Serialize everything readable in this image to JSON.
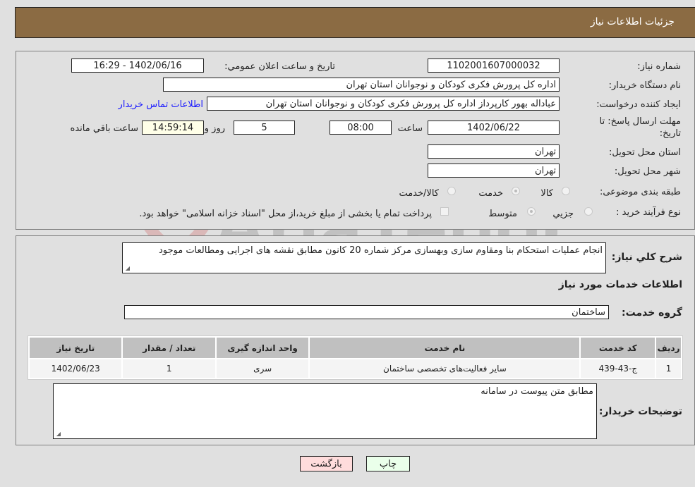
{
  "header": {
    "title": "جزئیات اطلاعات نیاز"
  },
  "fields": {
    "need_number_label": "شماره نیاز:",
    "need_number": "1102001607000032",
    "announce_label": "تاریخ و ساعت اعلان عمومي:",
    "announce_value": "1402/06/16 - 16:29",
    "buyer_org_label": "نام دستگاه خریدار:",
    "buyer_org": "اداره کل پرورش فکری کودکان و نوجوانان استان تهران",
    "creator_label": "ایجاد کننده درخواست:",
    "creator": "عباداله بهور کارپرداز اداره کل پرورش فکری کودکان و نوجوانان استان تهران",
    "contact_link": "اطلاعات تماس خریدار",
    "deadline_label": "مهلت ارسال پاسخ: تا تاریخ:",
    "deadline_date": "1402/06/22",
    "time_label": "ساعت",
    "deadline_time": "08:00",
    "days_value": "5",
    "days_label": "روز و",
    "remaining_time": "14:59:14",
    "remaining_label": "ساعت باقي مانده",
    "province_label": "استان محل تحویل:",
    "province": "تهران",
    "city_label": "شهر محل تحویل:",
    "city": "تهران",
    "category_label": "طبقه بندی موضوعی:",
    "category_options": [
      "کالا",
      "خدمت",
      "کالا/خدمت"
    ],
    "category_selected": "خدمت",
    "process_label": "نوع فرآیند خرید :",
    "process_options": [
      "جزيي",
      "متوسط"
    ],
    "process_selected": "متوسط",
    "treasury_note": "پرداخت تمام یا بخشی از مبلغ خرید،از محل \"اسناد خزانه اسلامی\" خواهد بود."
  },
  "description": {
    "label": "شرح کلي نیاز:",
    "text": "انجام عملیات استحکام بنا ومقاوم سازی وبهسازی مرکز شماره 20 کانون مطابق نقشه های اجرایی ومطالعات موجود"
  },
  "services": {
    "section_title": "اطلاعات خدمات مورد نیاز",
    "group_label": "گروه خدمت:",
    "group_value": "ساختمان",
    "table": {
      "headers": [
        "ردیف",
        "کد خدمت",
        "نام خدمت",
        "واحد اندازه گیری",
        "تعداد / مقدار",
        "تاریخ نیاز"
      ],
      "rows": [
        [
          "1",
          "ج-43-439",
          "سایر فعالیت‌های تخصصی ساختمان",
          "سری",
          "1",
          "1402/06/23"
        ]
      ]
    }
  },
  "buyer_notes": {
    "label": "توضیحات خریدار:",
    "text": "مطابق متن پیوست در سامانه"
  },
  "buttons": {
    "print": "چاپ",
    "back": "بازگشت"
  },
  "colors": {
    "header_bg": "#8b6b43",
    "print_bg": "#eaffea",
    "back_bg": "#ffdcdc",
    "link": "#1a1aff"
  }
}
